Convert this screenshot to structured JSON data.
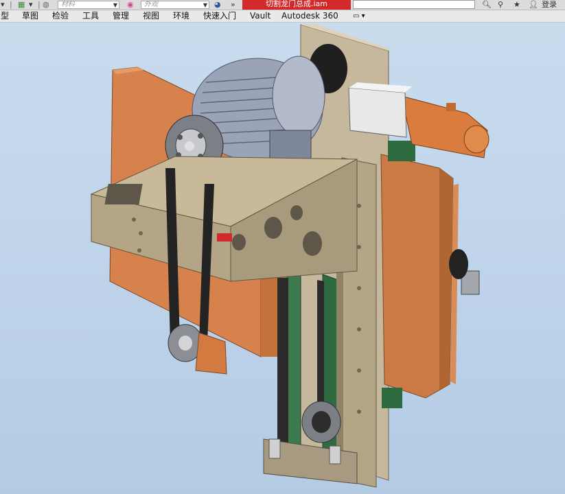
{
  "toolbar": {
    "material_placeholder": "材料",
    "appearance_placeholder": "外观",
    "document_title": "切割龙门总成.iam",
    "login_label": "登录"
  },
  "menu": {
    "items": [
      "型",
      "草图",
      "检验",
      "工具",
      "管理",
      "视图",
      "环境",
      "快速入门",
      "Vault",
      "Autodesk 360"
    ]
  },
  "colors": {
    "viewport_top": "#c9dcee",
    "viewport_bottom": "#b4cbe4",
    "title_tab": "#d22a2a",
    "orange_plate": "#d7824d",
    "tan_frame": "#b5a587",
    "motor": "#9aa3b8",
    "green_rail": "#3d7a4f"
  }
}
